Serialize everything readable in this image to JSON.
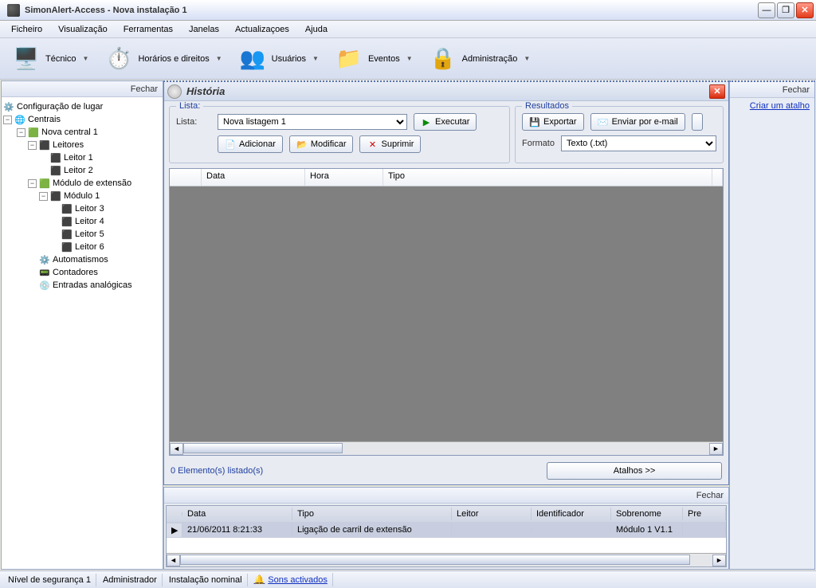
{
  "window": {
    "title": "SimonAlert-Access - Nova instalação 1"
  },
  "menu": {
    "ficheiro": "Ficheiro",
    "visualizacao": "Visualização",
    "ferramentas": "Ferramentas",
    "janelas": "Janelas",
    "actualizacoes": "Actualizaçoes",
    "ajuda": "Ajuda"
  },
  "toolbar": {
    "tecnico": "Técnico",
    "horarios": "Horários e direitos",
    "usuarios": "Usuários",
    "eventos": "Eventos",
    "administracao": "Administração"
  },
  "left": {
    "fechar": "Fechar",
    "config": "Configuração de lugar",
    "centrais": "Centrais",
    "nova1": "Nova central 1",
    "leitores": "Leitores",
    "leitor1": "Leitor 1",
    "leitor2": "Leitor 2",
    "modext": "Módulo de extensão",
    "modulo1": "Módulo 1",
    "leitor3": "Leitor 3",
    "leitor4": "Leitor 4",
    "leitor5": "Leitor 5",
    "leitor6": "Leitor 6",
    "automatismos": "Automatismos",
    "contadores": "Contadores",
    "entradas": "Entradas analógicas"
  },
  "historia": {
    "title": "História",
    "lista_group": "Lista:",
    "resultados_group": "Resultados",
    "lista_label": "Lista:",
    "lista_selected": "Nova listagem 1",
    "executar": "Executar",
    "adicionar": "Adicionar",
    "modificar": "Modificar",
    "suprimir": "Suprimir",
    "exportar": "Exportar",
    "enviar_email": "Enviar por e-mail",
    "formato_label": "Formato",
    "formato_selected": "Texto (.txt)",
    "cols": {
      "data": "Data",
      "hora": "Hora",
      "tipo": "Tipo"
    },
    "count": "0 Elemento(s) listado(s)",
    "atalhos": "Atalhos >>"
  },
  "log": {
    "fechar": "Fechar",
    "cols": {
      "data": "Data",
      "tipo": "Tipo",
      "leitor": "Leitor",
      "identificador": "Identificador",
      "sobrenome": "Sobrenome",
      "pre": "Pre"
    },
    "row": {
      "data": "21/06/2011 8:21:33",
      "tipo": "Ligação de carril de extensão",
      "leitor": "",
      "identificador": "",
      "sobrenome": "Módulo 1 V1.1",
      "pre": ""
    }
  },
  "right": {
    "fechar": "Fechar",
    "criar": "Criar um atalho"
  },
  "status": {
    "nivel": "Nível de segurança 1",
    "admin": "Administrador",
    "instalacao": "Instalação nominal",
    "sons": "Sons activados"
  }
}
